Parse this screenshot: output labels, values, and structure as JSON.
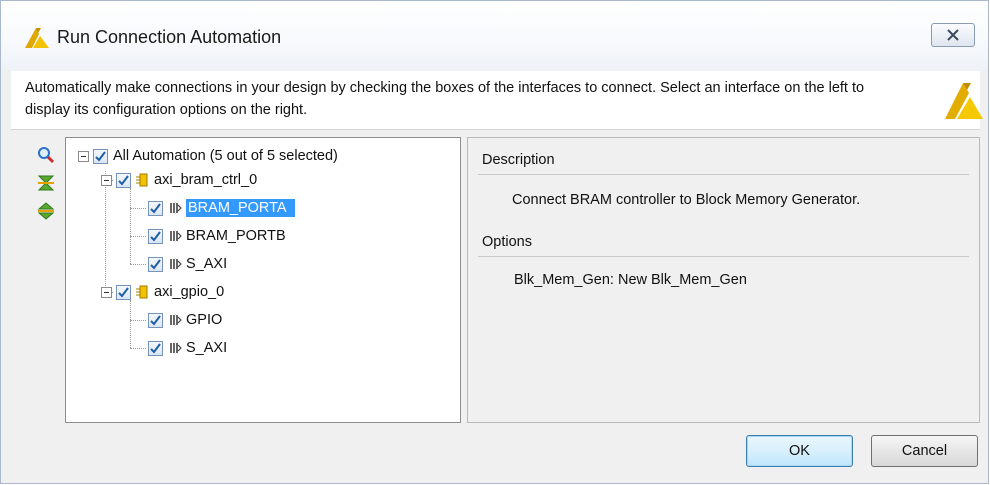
{
  "window": {
    "title": "Run Connection Automation",
    "close_icon": "close-icon"
  },
  "banner": {
    "text": "Automatically make connections in your design by checking the boxes of the interfaces to connect. Select an interface on the left to display its configuration options on the right.",
    "logo_icon": "vivado-logo-icon"
  },
  "tools": [
    "search-icon",
    "collapse-all-icon",
    "expand-all-icon"
  ],
  "tree": {
    "root": {
      "label": "All Automation (5 out of 5 selected)",
      "checked": true
    },
    "groups": [
      {
        "label": "axi_bram_ctrl_0",
        "checked": true,
        "children": [
          {
            "label": "BRAM_PORTA",
            "checked": true,
            "selected": true
          },
          {
            "label": "BRAM_PORTB",
            "checked": true,
            "selected": false
          },
          {
            "label": "S_AXI",
            "checked": true,
            "selected": false
          }
        ]
      },
      {
        "label": "axi_gpio_0",
        "checked": true,
        "children": [
          {
            "label": "GPIO",
            "checked": true,
            "selected": false
          },
          {
            "label": "S_AXI",
            "checked": true,
            "selected": false
          }
        ]
      }
    ]
  },
  "details": {
    "description_title": "Description",
    "description_text": "Connect BRAM controller to Block Memory Generator.",
    "options_title": "Options",
    "option_label": "Blk_Mem_Gen:",
    "option_value": "New Blk_Mem_Gen"
  },
  "buttons": {
    "ok": "OK",
    "cancel": "Cancel"
  },
  "colors": {
    "selection": "#3399ff",
    "check": "#1e5fa8",
    "accent_logo": "#e8b400"
  }
}
